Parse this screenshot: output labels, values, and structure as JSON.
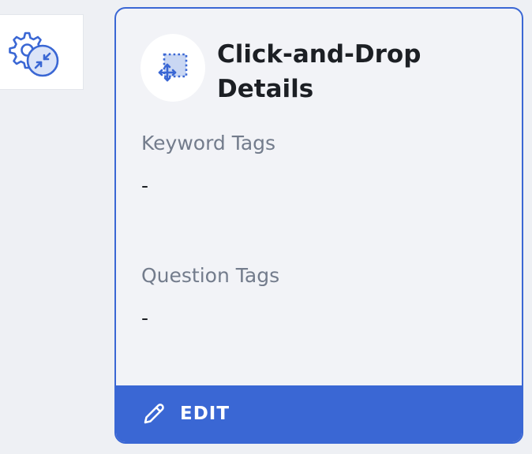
{
  "sidebar": {
    "settings_icon": "gear-with-compress-arrows-icon"
  },
  "card": {
    "icon": "drag-and-drop-move-icon",
    "title": "Click-and-Drop Details",
    "fields": [
      {
        "label": "Keyword Tags",
        "value": "-"
      },
      {
        "label": "Question Tags",
        "value": "-"
      }
    ],
    "edit_label": "EDIT",
    "edit_icon": "pencil-icon"
  },
  "colors": {
    "accent": "#3a67d4",
    "card_bg": "#f2f3f7",
    "page_bg": "#eef0f4",
    "label_text": "#737c8c",
    "body_text": "#1c1f24"
  }
}
